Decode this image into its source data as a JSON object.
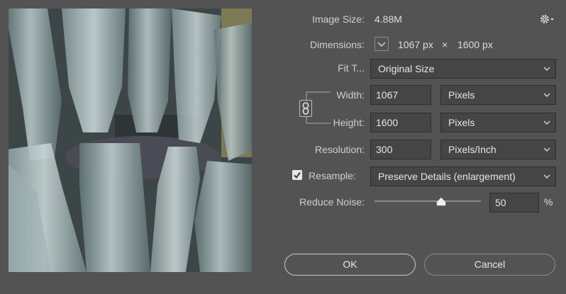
{
  "image_size": {
    "label": "Image Size:",
    "value": "4.88M",
    "gear_icon": "gear-icon"
  },
  "dimensions": {
    "label": "Dimensions:",
    "width": "1067 px",
    "times": "×",
    "height": "1600 px"
  },
  "fit_to": {
    "label": "Fit T...",
    "value": "Original Size"
  },
  "width": {
    "label": "Width:",
    "value": "1067",
    "unit": "Pixels"
  },
  "height": {
    "label": "Height:",
    "value": "1600",
    "unit": "Pixels"
  },
  "resolution": {
    "label": "Resolution:",
    "value": "300",
    "unit": "Pixels/Inch"
  },
  "resample": {
    "label": "Resample:",
    "checked": true,
    "value": "Preserve Details (enlargement)"
  },
  "reduce_noise": {
    "label": "Reduce Noise:",
    "value": "50",
    "unit": "%",
    "slider_fraction": 0.625
  },
  "buttons": {
    "ok": "OK",
    "cancel": "Cancel"
  },
  "colors": {
    "background": "#535353",
    "field": "#454545",
    "text": "#d6d6d6"
  }
}
